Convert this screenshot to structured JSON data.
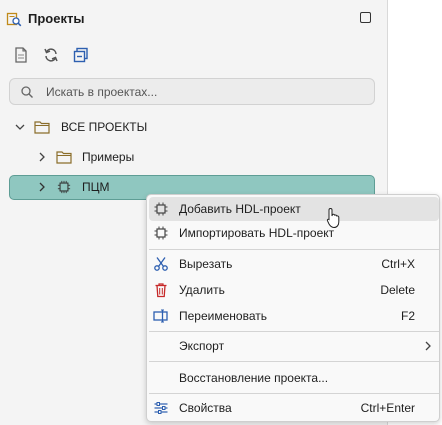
{
  "panel": {
    "title": "Проекты",
    "toolbar": [
      {
        "icon": "new-file-icon"
      },
      {
        "icon": "refresh-icon"
      },
      {
        "icon": "collapse-all-icon"
      }
    ],
    "search": {
      "placeholder": "Искать в проектах..."
    }
  },
  "tree": {
    "root": {
      "label": "ВСЕ ПРОЕКТЫ",
      "expanded": true
    },
    "items": [
      {
        "label": "Примеры",
        "icon": "folder-icon",
        "expanded": false
      },
      {
        "label": "ПЦМ",
        "icon": "chip-icon",
        "expanded": false,
        "selected": true
      }
    ]
  },
  "context_menu": {
    "items": [
      {
        "label": "Добавить HDL-проект",
        "shortcut": "",
        "icon": "chip-add-icon"
      },
      {
        "label": "Импортировать HDL-проект",
        "shortcut": "",
        "icon": "chip-import-icon"
      },
      {
        "label": "Вырезать",
        "shortcut": "Ctrl+X",
        "icon": "scissors-icon"
      },
      {
        "label": "Удалить",
        "shortcut": "Delete",
        "icon": "trash-icon"
      },
      {
        "label": "Переименовать",
        "shortcut": "F2",
        "icon": "rename-icon"
      },
      {
        "label": "Экспорт",
        "shortcut": "",
        "icon": ""
      },
      {
        "label": "Восстановление проекта...",
        "shortcut": "",
        "icon": ""
      },
      {
        "label": "Свойства",
        "shortcut": "Ctrl+Enter",
        "icon": "sliders-icon"
      }
    ]
  },
  "colors": {
    "selection": "#8fc7c0",
    "accent": "#5e9d95",
    "danger": "#c62828",
    "icon_blue": "#2d5fb0"
  }
}
